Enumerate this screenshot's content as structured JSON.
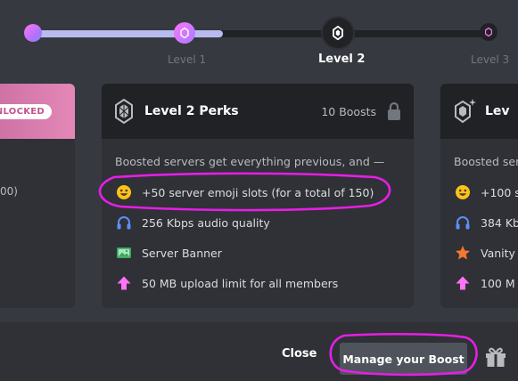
{
  "progress": {
    "levels": [
      {
        "label": "Level 1",
        "state": "unlocked"
      },
      {
        "label": "Level 2",
        "state": "selected"
      },
      {
        "label": "Level 3",
        "state": "locked"
      }
    ]
  },
  "cards": {
    "left": {
      "badge": "UNLOCKED",
      "fragment": "00)"
    },
    "main": {
      "title": "Level 2 Perks",
      "boosts": "10 Boosts",
      "intro": "Boosted servers get everything previous, and —",
      "perks": [
        {
          "icon": "emoji-smile-icon",
          "text": "+50 server emoji slots (for a total of 150)"
        },
        {
          "icon": "headphones-icon",
          "text": "256 Kbps audio quality"
        },
        {
          "icon": "image-banner-icon",
          "text": "Server Banner"
        },
        {
          "icon": "upload-arrow-icon",
          "text": "50 MB upload limit for all members"
        }
      ]
    },
    "right": {
      "title": "Lev",
      "intro": "Boosted ser",
      "perks": [
        {
          "icon": "emoji-smile-icon",
          "text": "+100 s"
        },
        {
          "icon": "headphones-icon",
          "text": "384 Kb"
        },
        {
          "icon": "star-icon",
          "text": "Vanity"
        },
        {
          "icon": "upload-arrow-icon",
          "text": "100 M"
        }
      ]
    }
  },
  "footer": {
    "close_label": "Close",
    "manage_label": "Manage your Boost"
  },
  "colors": {
    "accent_pink": "#ff73fa",
    "annotation": "#e61ee6",
    "background": "#36393f"
  }
}
